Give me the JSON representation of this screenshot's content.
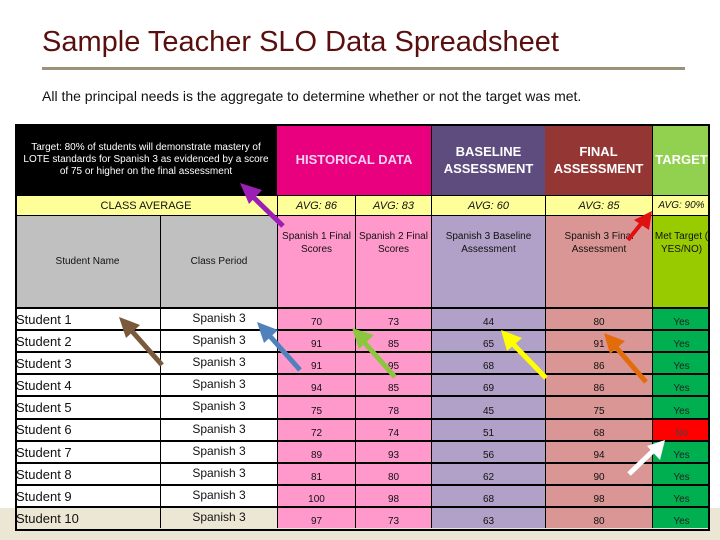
{
  "slide": {
    "title": "Sample Teacher SLO Data Spreadsheet",
    "subtitle": "All the principal needs is the aggregate to determine whether or not the target was met."
  },
  "table": {
    "target_statement": "Target: 80% of students will demonstrate mastery of LOTE standards for Spanish 3 as evidenced by a score of 75 or higher on the final assessment",
    "group_headers": {
      "historical": "HISTORICAL DATA",
      "baseline": "BASELINE ASSESSMENT",
      "final": "FINAL ASSESSMENT",
      "target": "TARGET"
    },
    "class_average_label": "CLASS AVERAGE",
    "averages": {
      "spanish1": "AVG: 86",
      "spanish2": "AVG: 83",
      "baseline": "AVG: 60",
      "final": "AVG: 85",
      "target": "AVG: 90%"
    },
    "column_headers": {
      "student_name": "Student Name",
      "class_period": "Class Period",
      "spanish1": "Spanish 1 Final Scores",
      "spanish2": "Spanish 2 Final Scores",
      "baseline": "Spanish 3 Baseline Assessment",
      "final": "Spanish 3 Final Assessment",
      "met_target": "Met Target ( YES/NO)"
    },
    "rows": [
      {
        "name": "Student 1",
        "period": "Spanish 3",
        "s1": "70",
        "s2": "73",
        "baseline": "44",
        "final": "80",
        "met": "Yes"
      },
      {
        "name": "Student 2",
        "period": "Spanish 3",
        "s1": "91",
        "s2": "85",
        "baseline": "65",
        "final": "91",
        "met": "Yes"
      },
      {
        "name": "Student 3",
        "period": "Spanish 3",
        "s1": "91",
        "s2": "95",
        "baseline": "68",
        "final": "86",
        "met": "Yes"
      },
      {
        "name": "Student 4",
        "period": "Spanish 3",
        "s1": "94",
        "s2": "85",
        "baseline": "69",
        "final": "86",
        "met": "Yes"
      },
      {
        "name": "Student 5",
        "period": "Spanish 3",
        "s1": "75",
        "s2": "78",
        "baseline": "45",
        "final": "75",
        "met": "Yes"
      },
      {
        "name": "Student 6",
        "period": "Spanish 3",
        "s1": "72",
        "s2": "74",
        "baseline": "51",
        "final": "68",
        "met": "No"
      },
      {
        "name": "Student 7",
        "period": "Spanish 3",
        "s1": "89",
        "s2": "93",
        "baseline": "56",
        "final": "94",
        "met": "Yes"
      },
      {
        "name": "Student 8",
        "period": "Spanish 3",
        "s1": "81",
        "s2": "80",
        "baseline": "62",
        "final": "90",
        "met": "Yes"
      },
      {
        "name": "Student 9",
        "period": "Spanish 3",
        "s1": "100",
        "s2": "98",
        "baseline": "68",
        "final": "98",
        "met": "Yes"
      },
      {
        "name": "Student 10",
        "period": "Spanish 3",
        "s1": "97",
        "s2": "73",
        "baseline": "63",
        "final": "80",
        "met": "Yes"
      }
    ]
  },
  "colors": {
    "title": "#5a0f0f",
    "historical": "#e8007f",
    "baseline": "#5e4c7f",
    "final": "#943634",
    "target": "#92d050",
    "yes": "#00b050",
    "no": "#ff0000",
    "average_row": "#ffff99"
  },
  "annotations": {
    "arrows": [
      {
        "name": "purple-arrow",
        "color": "#9b1fb5",
        "points_to": "target-statement"
      },
      {
        "name": "red-arrow",
        "color": "#e01010",
        "points_to": "target-average"
      },
      {
        "name": "brown-arrow",
        "color": "#7a5a3a",
        "points_to": "student-name-column"
      },
      {
        "name": "blue-arrow",
        "color": "#4f81bd",
        "points_to": "class-period-column"
      },
      {
        "name": "green-arrow",
        "color": "#8cc63f",
        "points_to": "historical-scores"
      },
      {
        "name": "yellow-arrow",
        "color": "#ffff00",
        "points_to": "baseline-scores"
      },
      {
        "name": "orange-arrow",
        "color": "#e36c0a",
        "points_to": "final-scores"
      },
      {
        "name": "white-arrow",
        "color": "#ffffff",
        "points_to": "met-target-no"
      }
    ]
  }
}
